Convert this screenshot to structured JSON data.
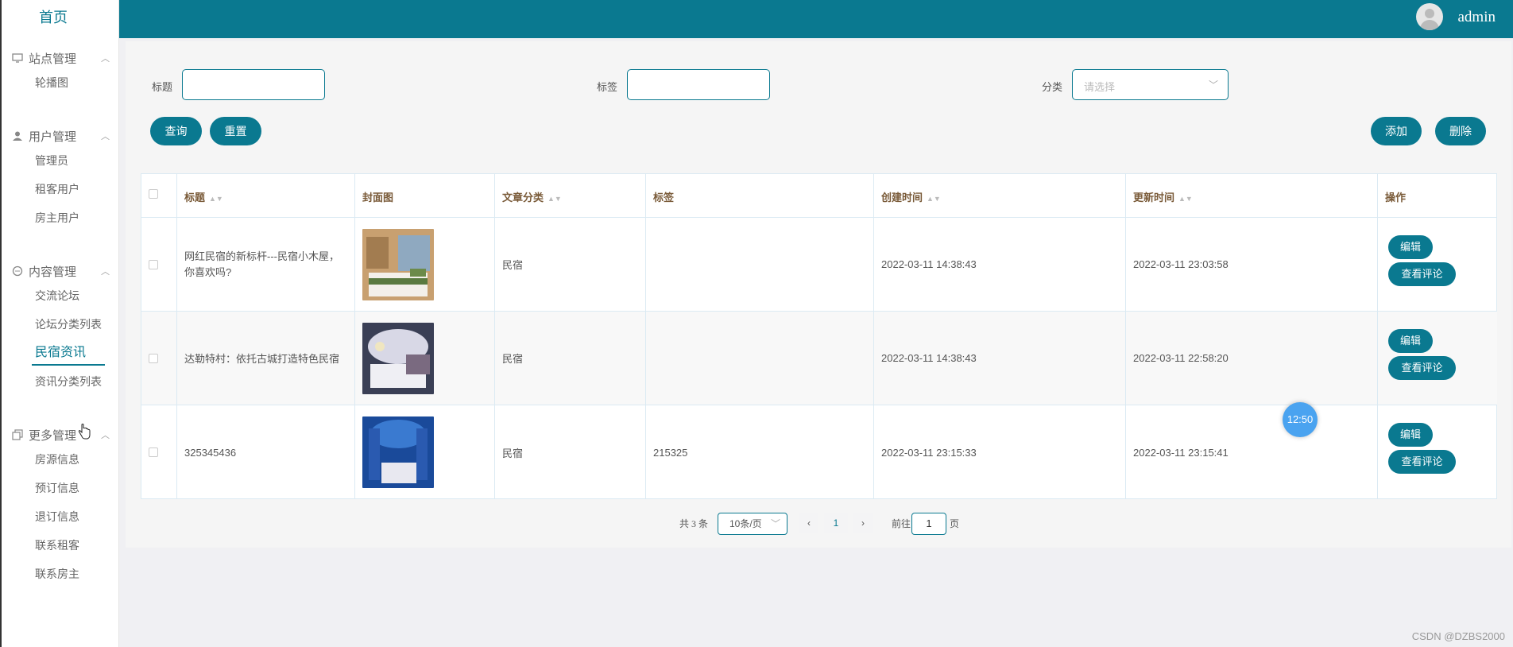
{
  "sidebar": {
    "home": "首页",
    "groups": [
      {
        "label": "站点管理",
        "icon": "monitor-icon",
        "items": [
          "轮播图"
        ]
      },
      {
        "label": "用户管理",
        "icon": "user-icon",
        "items": [
          "管理员",
          "租客用户",
          "房主用户"
        ]
      },
      {
        "label": "内容管理",
        "icon": "chat-icon",
        "items": [
          "交流论坛",
          "论坛分类列表",
          "民宿资讯",
          "资讯分类列表"
        ]
      },
      {
        "label": "更多管理",
        "icon": "copy-icon",
        "items": [
          "房源信息",
          "预订信息",
          "退订信息",
          "联系租客",
          "联系房主"
        ]
      }
    ],
    "active_item": "民宿资讯"
  },
  "header": {
    "username": "admin"
  },
  "filters": {
    "title_label": "标题",
    "title_value": "",
    "tag_label": "标签",
    "tag_value": "",
    "category_label": "分类",
    "category_placeholder": "请选择"
  },
  "actions": {
    "query": "查询",
    "reset": "重置",
    "add": "添加",
    "delete": "删除"
  },
  "table": {
    "columns": [
      "标题",
      "封面图",
      "文章分类",
      "标签",
      "创建时间",
      "更新时间",
      "操作"
    ],
    "rows": [
      {
        "title": "网红民宿的新标杆---民宿小木屋，你喜欢吗?",
        "category": "民宿",
        "tag": "",
        "created": "2022-03-11 14:38:43",
        "updated": "2022-03-11 23:03:58",
        "thumb_colors": [
          "#c8a070",
          "#8fa9c0",
          "#5a7a40"
        ]
      },
      {
        "title": "达勒特村：依托古城打造特色民宿",
        "category": "民宿",
        "tag": "",
        "created": "2022-03-11 14:38:43",
        "updated": "2022-03-11 22:58:20",
        "thumb_colors": [
          "#3a3f55",
          "#d8d8e6",
          "#7a6a80"
        ]
      },
      {
        "title": "325345436",
        "category": "民宿",
        "tag": "215325",
        "created": "2022-03-11 23:15:33",
        "updated": "2022-03-11 23:15:41",
        "thumb_colors": [
          "#1a4a9a",
          "#3a7ad0",
          "#e8e8f0"
        ]
      }
    ],
    "row_actions": {
      "edit": "编辑",
      "view_comments": "查看评论"
    }
  },
  "pagination": {
    "total": "共 3 条",
    "page_size": "10条/页",
    "current_page": "1",
    "goto_prefix": "前往",
    "goto_value": "1",
    "goto_suffix": "页"
  },
  "overlay": {
    "timer": "12:50",
    "watermark": "CSDN @DZBS2000"
  },
  "colors": {
    "primary": "#0a7990",
    "header_text": "#7a5b39"
  }
}
